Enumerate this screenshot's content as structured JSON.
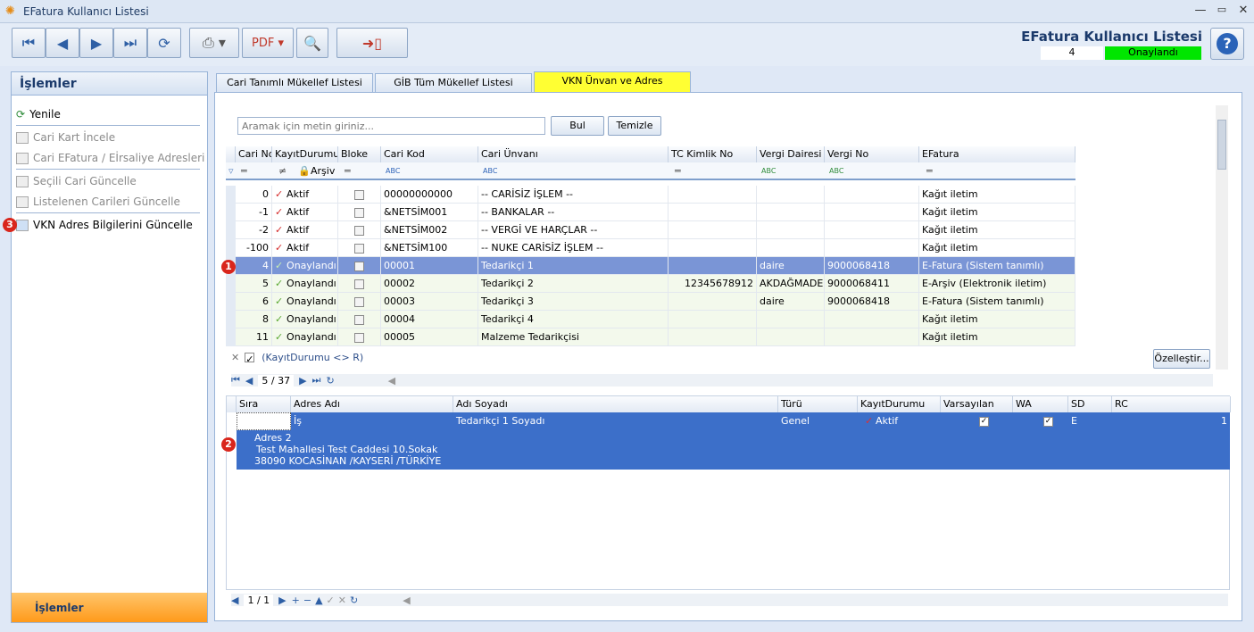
{
  "window": {
    "title": "EFatura Kullanıcı Listesi",
    "min": "—",
    "max": "▭",
    "close": "✕"
  },
  "header": {
    "title": "EFatura Kullanıcı Listesi",
    "count": "4",
    "status": "Onaylandı",
    "help": "?"
  },
  "colors": {
    "selected_row": "#7a95d6",
    "address_bg": "#3c6fc9",
    "status_green": "#00e600",
    "tab_active": "#ffff33",
    "footer_orange": "#ff9a1a"
  },
  "toolbar": {
    "icons": [
      "first-icon",
      "prev-icon",
      "next-icon",
      "last-icon",
      "refresh-icon",
      "print-icon",
      "pdf-icon",
      "search-tool-icon",
      "exit-icon"
    ]
  },
  "sidebar": {
    "title": "İşlemler",
    "footer": "İşlemler",
    "items": [
      {
        "label": "Yenile",
        "enabled": true
      },
      {
        "label": "Cari Kart İncele",
        "enabled": false
      },
      {
        "label": "Cari EFatura / Eİrsaliye Adresleri",
        "enabled": false
      },
      {
        "label": "Seçili Cari Güncelle",
        "enabled": false
      },
      {
        "label": "Listelenen Carileri Güncelle",
        "enabled": false
      },
      {
        "label": "VKN Adres Bilgilerini Güncelle",
        "enabled": true
      }
    ]
  },
  "badges": {
    "b1": "1",
    "b2": "2",
    "b3": "3"
  },
  "tabs": [
    {
      "label": "Cari Tanımlı Mükellef Listesi"
    },
    {
      "label": "GİB Tüm Mükellef Listesi"
    },
    {
      "label": "VKN Ünvan ve Adres"
    }
  ],
  "search": {
    "placeholder": "Aramak için metin giriniz...",
    "find": "Bul",
    "clear": "Temizle"
  },
  "grid": {
    "columns": [
      "Cari No",
      "KayıtDurumu",
      "Bloke",
      "Cari Kod",
      "Cari Ünvanı",
      "TC Kimlik No",
      "Vergi Dairesi",
      "Vergi No",
      "EFatura"
    ],
    "filter": {
      "arsiv": "Arşiv",
      "abc": "ABC"
    },
    "rows": [
      {
        "no": "0",
        "durum": "Aktif",
        "kod": "00000000000",
        "unvan": "-- CARİSİZ İŞLEM --",
        "tc": "",
        "daire": "",
        "vno": "",
        "efatura": "Kağıt iletim"
      },
      {
        "no": "-1",
        "durum": "Aktif",
        "kod": "&NETSİM001",
        "unvan": "-- BANKALAR --",
        "tc": "",
        "daire": "",
        "vno": "",
        "efatura": "Kağıt iletim"
      },
      {
        "no": "-2",
        "durum": "Aktif",
        "kod": "&NETSİM002",
        "unvan": "-- VERGİ VE HARÇLAR --",
        "tc": "",
        "daire": "",
        "vno": "",
        "efatura": "Kağıt iletim"
      },
      {
        "no": "-100",
        "durum": "Aktif",
        "kod": "&NETSİM100",
        "unvan": "-- NUKE CARİSİZ İŞLEM --",
        "tc": "",
        "daire": "",
        "vno": "",
        "efatura": "Kağıt iletim"
      },
      {
        "no": "4",
        "durum": "Onaylandı",
        "kod": "00001",
        "unvan": "Tedarikçi 1",
        "tc": "",
        "daire": "daire",
        "vno": "9000068418",
        "efatura": "E-Fatura (Sistem tanımlı)"
      },
      {
        "no": "5",
        "durum": "Onaylandı",
        "kod": "00002",
        "unvan": "Tedarikçi 2",
        "tc": "12345678912",
        "daire": "AKDAĞMADENİ",
        "vno": "9000068411",
        "efatura": "E-Arşiv (Elektronik iletim)"
      },
      {
        "no": "6",
        "durum": "Onaylandı",
        "kod": "00003",
        "unvan": "Tedarikçi 3",
        "tc": "",
        "daire": "daire",
        "vno": "9000068418",
        "efatura": "E-Fatura (Sistem tanımlı)"
      },
      {
        "no": "8",
        "durum": "Onaylandı",
        "kod": "00004",
        "unvan": "Tedarikçi 4",
        "tc": "",
        "daire": "",
        "vno": "",
        "efatura": "Kağıt iletim"
      },
      {
        "no": "11",
        "durum": "Onaylandı",
        "kod": "00005",
        "unvan": "Malzeme Tedarikçisi",
        "tc": "",
        "daire": "",
        "vno": "",
        "efatura": "Kağıt iletim"
      }
    ],
    "filter_text": "(KayıtDurumu <> R)",
    "customize": "Özelleştir...",
    "pager": "5 / 37"
  },
  "addr": {
    "columns": [
      "Sıra",
      "Adres Adı",
      "Adı Soyadı",
      "Türü",
      "KayıtDurumu",
      "Varsayılan",
      "WA",
      "SD",
      "RC"
    ],
    "row": {
      "sira": "",
      "adres": "İş",
      "ad": "Tedarikçi 1 Soyadı",
      "tur": "Genel",
      "durum": "Aktif",
      "sd": "E",
      "rc": "1"
    },
    "detail": [
      "Adres 2",
      "Test Mahallesi Test Caddesi 10.Sokak",
      "38090     KOCASİNAN /KAYSERİ /TÜRKİYE"
    ],
    "pager": "1 / 1"
  }
}
